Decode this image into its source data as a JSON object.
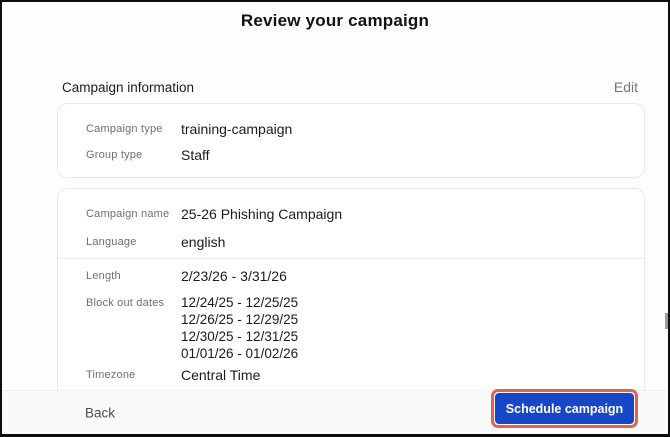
{
  "header": {
    "title": "Review your campaign"
  },
  "section": {
    "title": "Campaign information",
    "edit_label": "Edit"
  },
  "card1": {
    "campaign_type": {
      "label": "Campaign type",
      "value": "training-campaign"
    },
    "group_type": {
      "label": "Group type",
      "value": "Staff"
    }
  },
  "card2": {
    "campaign_name": {
      "label": "Campaign name",
      "value": "25-26 Phishing Campaign"
    },
    "language": {
      "label": "Language",
      "value": "english"
    },
    "length": {
      "label": "Length",
      "value": "2/23/26 - 3/31/26"
    },
    "block_out_dates": {
      "label": "Block out dates",
      "values": [
        "12/24/25 - 12/25/25",
        "12/26/25 - 12/29/25",
        "12/30/25 - 12/31/25",
        "01/01/26 - 01/02/26"
      ]
    },
    "timezone": {
      "label": "Timezone",
      "value": "Central Time"
    }
  },
  "footer": {
    "back_label": "Back",
    "schedule_label": "Schedule campaign"
  },
  "colors": {
    "button_blue": "#1747c8",
    "annotation_red": "#e8604f"
  }
}
